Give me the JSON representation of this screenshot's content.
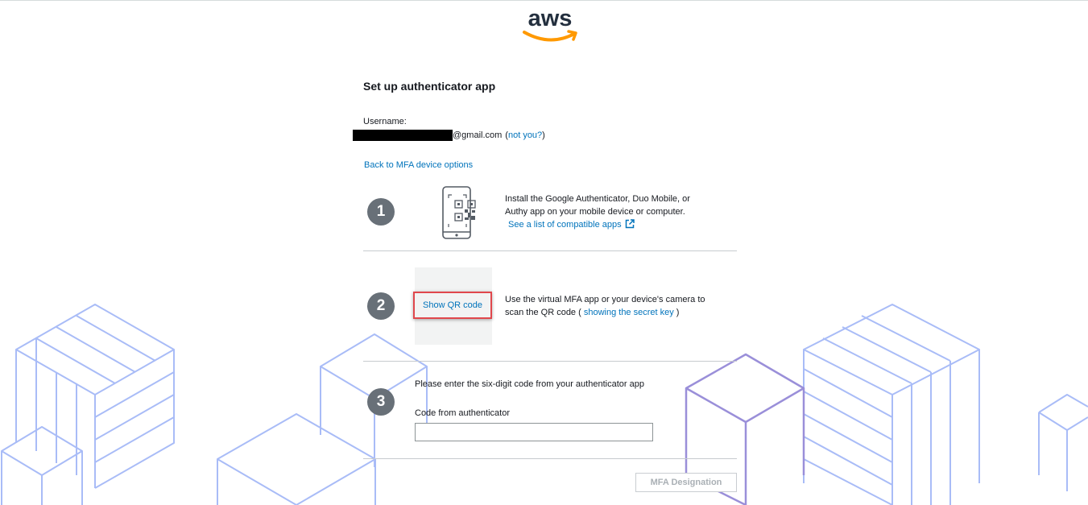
{
  "brand": {
    "logo_text": "aws",
    "accent": "#ff9900",
    "link_color": "#0073bb"
  },
  "page": {
    "title": "Set up authenticator app"
  },
  "user": {
    "username_label": "Username:",
    "email_suffix": "@gmail.com",
    "open_paren": "(",
    "not_you": "not you?",
    "close_paren": ")"
  },
  "back_link": "Back to MFA device options",
  "steps": [
    {
      "number": "1",
      "line1": "Install the Google Authenticator, Duo Mobile, or",
      "line2": "Authy app on your mobile device or computer.",
      "link": "See a list of compatible apps",
      "icon": "phone-qr-icon"
    },
    {
      "number": "2",
      "button": "Show QR code",
      "line1": "Use the virtual MFA app or your device's camera to",
      "line2_prefix": "scan the QR code (",
      "line2_link": "showing the secret key",
      "line2_suffix": ")"
    },
    {
      "number": "3",
      "instruction": "Please enter the six-digit code from your authenticator app",
      "field_label": "Code from authenticator",
      "field_value": "",
      "field_placeholder": ""
    }
  ],
  "footer": {
    "button": "MFA Designation"
  }
}
